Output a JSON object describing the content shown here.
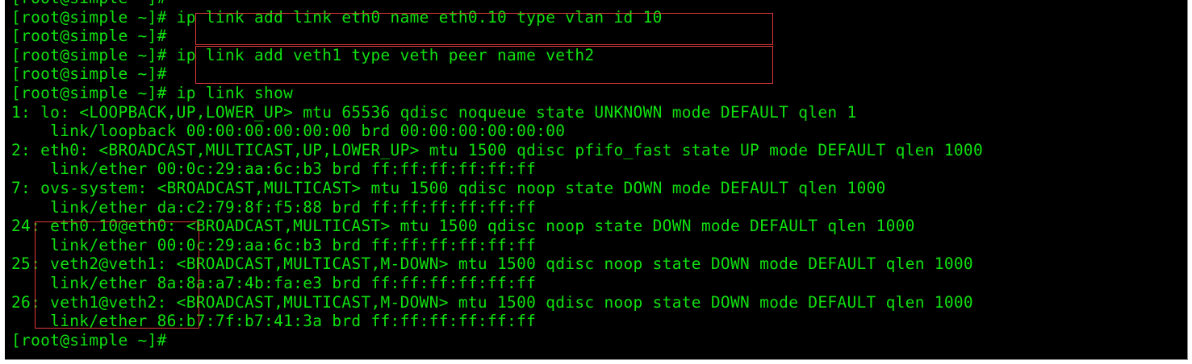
{
  "terminal": {
    "lines": [
      "[root@simple ~]#",
      "[root@simple ~]# ip link add link eth0 name eth0.10 type vlan id 10",
      "[root@simple ~]#",
      "[root@simple ~]# ip link add veth1 type veth peer name veth2",
      "[root@simple ~]#",
      "[root@simple ~]# ip link show",
      "1: lo: <LOOPBACK,UP,LOWER_UP> mtu 65536 qdisc noqueue state UNKNOWN mode DEFAULT qlen 1",
      "    link/loopback 00:00:00:00:00:00 brd 00:00:00:00:00:00",
      "2: eth0: <BROADCAST,MULTICAST,UP,LOWER_UP> mtu 1500 qdisc pfifo_fast state UP mode DEFAULT qlen 1000",
      "    link/ether 00:0c:29:aa:6c:b3 brd ff:ff:ff:ff:ff:ff",
      "7: ovs-system: <BROADCAST,MULTICAST> mtu 1500 qdisc noop state DOWN mode DEFAULT qlen 1000",
      "    link/ether da:c2:79:8f:f5:88 brd ff:ff:ff:ff:ff:ff",
      "24: eth0.10@eth0: <BROADCAST,MULTICAST> mtu 1500 qdisc noop state DOWN mode DEFAULT qlen 1000",
      "    link/ether 00:0c:29:aa:6c:b3 brd ff:ff:ff:ff:ff:ff",
      "25: veth2@veth1: <BROADCAST,MULTICAST,M-DOWN> mtu 1500 qdisc noop state DOWN mode DEFAULT qlen 1000",
      "    link/ether 8a:8a:a7:4b:fa:e3 brd ff:ff:ff:ff:ff:ff",
      "26: veth1@veth2: <BROADCAST,MULTICAST,M-DOWN> mtu 1500 qdisc noop state DOWN mode DEFAULT qlen 1000",
      "    link/ether 86:b7:7f:b7:41:3a brd ff:ff:ff:ff:ff:ff",
      "[root@simple ~]#"
    ]
  },
  "colors": {
    "background": "#000000",
    "text": "#10e010",
    "highlight_box": "#e2393b"
  }
}
